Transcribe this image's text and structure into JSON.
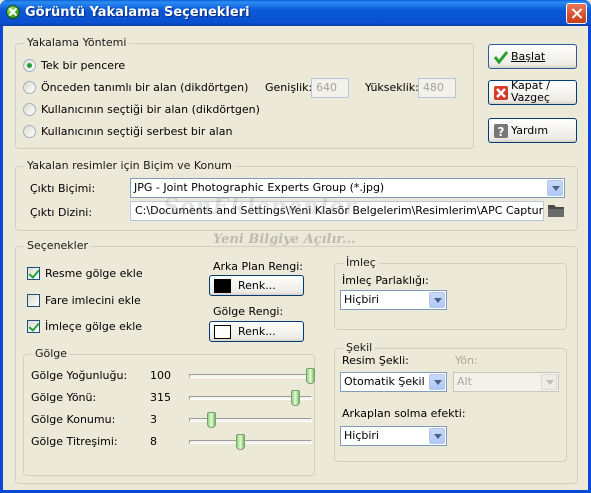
{
  "window": {
    "title": "Görüntü Yakalama Seçenekleri"
  },
  "capture_method": {
    "legend": "Yakalama Yöntemi",
    "options": [
      {
        "label": "Tek bir pencere",
        "selected": true
      },
      {
        "label": "Önceden tanımlı bir alan (dikdörtgen)",
        "selected": false
      },
      {
        "label": "Kullanıcının seçtiği bir alan (dikdörtgen)",
        "selected": false
      },
      {
        "label": "Kullanıcının seçtiği serbest bir alan",
        "selected": false
      }
    ],
    "width_label": "Genişlik:",
    "width_value": "640",
    "height_label": "Yükseklik:",
    "height_value": "480"
  },
  "buttons": {
    "start": "Başlat",
    "close": "Kapat / Vazgeç",
    "help": "Yardım"
  },
  "format": {
    "legend": "Yakalan resimler için Biçim ve Konum",
    "output_format_label": "Çıktı Biçimi:",
    "output_format_value": "JPG - Joint Photographic Experts Group (*.jpg)",
    "output_dir_label": "Çıktı Dizini:",
    "output_dir_value": "C:\\Documents and Settings\\Yeni Klasör Belgelerim\\Resimlerim\\APC Capture"
  },
  "watermark": {
    "text1": "Yeni Bilgiye Açılır...",
    "text2": "SonEklenenler"
  },
  "options": {
    "legend": "Seçenekler",
    "add_shadow": {
      "label": "Resme gölge ekle",
      "checked": true
    },
    "mouse_pointer": {
      "label": "Fare imlecini ekle",
      "checked": false
    },
    "cursor_shadow": {
      "label": "İmleçe gölge ekle",
      "checked": true
    },
    "bg_color_label": "Arka Plan Rengi:",
    "shadow_color_label": "Gölge Rengi:",
    "color_button": "Renk...",
    "bg_color": "#000000",
    "shadow_color": "#ffffff"
  },
  "shadow": {
    "legend": "Gölge",
    "sliders": [
      {
        "label": "Gölge Yoğunluğu:",
        "value": "100",
        "level": 1.0
      },
      {
        "label": "Gölge Yönü:",
        "value": "315",
        "level": 0.875
      },
      {
        "label": "Gölge Konumu:",
        "value": "3",
        "level": 0.15
      },
      {
        "label": "Gölge Titreşimi:",
        "value": "8",
        "level": 0.4
      }
    ]
  },
  "cursor": {
    "legend": "İmleç",
    "brightness_label": "İmleç Parlaklığı:",
    "brightness_value": "Hiçbiri"
  },
  "shape": {
    "legend": "Şekil",
    "shape_label": "Resim Şekli:",
    "shape_value": "Otomatik Şekil",
    "direction_label": "Yön:",
    "direction_value": "Alt",
    "fade_label": "Arkaplan solma efekti:",
    "fade_value": "Hiçbiri"
  },
  "colors": {
    "title_bar": "#0a58d8",
    "dialog": "#ece9d8",
    "radio_check_accent": "#22a33a",
    "close_button": "#c93a17"
  }
}
